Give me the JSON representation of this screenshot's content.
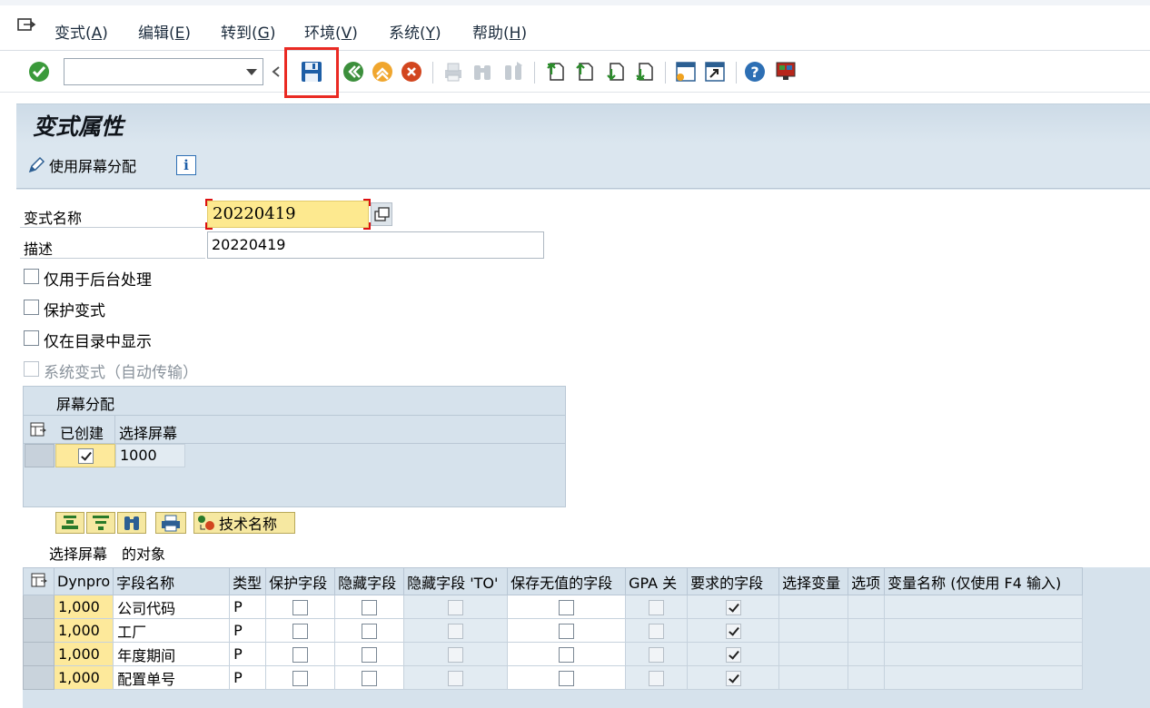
{
  "menubar": {
    "items": [
      {
        "label": "变式(",
        "key": "A",
        "tail": ")"
      },
      {
        "label": "编辑(",
        "key": "E",
        "tail": ")"
      },
      {
        "label": "转到(",
        "key": "G",
        "tail": ")"
      },
      {
        "label": "环境(",
        "key": "V",
        "tail": ")"
      },
      {
        "label": "系统(",
        "key": "Y",
        "tail": ")"
      },
      {
        "label": "帮助(",
        "key": "H",
        "tail": ")"
      }
    ]
  },
  "toolbar": {
    "command_field": "",
    "icons": [
      "enter-icon",
      "save-icon",
      "back-icon",
      "exit-icon",
      "cancel-icon",
      "print-icon",
      "find-icon",
      "find-next-icon",
      "first-page-icon",
      "previous-page-icon",
      "next-page-icon",
      "last-page-icon",
      "create-session-icon",
      "shortcut-icon",
      "help-icon",
      "customize-layout-icon"
    ],
    "highlight_color": "#ea2a23"
  },
  "title": "变式属性",
  "app_toolbar": {
    "use_screen_assignment": "使用屏幕分配",
    "info": "i"
  },
  "form": {
    "variant_name_label": "变式名称",
    "variant_name_value": "20220419",
    "description_label": "描述",
    "description_value": "20220419",
    "checkboxes": [
      {
        "label": "仅用于后台处理",
        "checked": false,
        "disabled": false
      },
      {
        "label": "保护变式",
        "checked": false,
        "disabled": false
      },
      {
        "label": "仅在目录中显示",
        "checked": false,
        "disabled": false
      },
      {
        "label": "系统变式（自动传输）",
        "checked": false,
        "disabled": true
      }
    ]
  },
  "screen_assignment": {
    "title": "屏幕分配",
    "columns": [
      "已创建",
      "选择屏幕"
    ],
    "rows": [
      {
        "created": true,
        "screen": "1000"
      }
    ]
  },
  "objects": {
    "toolbar_button": "技术名称",
    "title": "选择屏幕　的对象",
    "columns": [
      "Dynpro",
      "字段名称",
      "类型",
      "保护字段",
      "隐藏字段",
      "隐藏字段 'TO'",
      "保存无值的字段",
      "GPA 关",
      "要求的字段",
      "选择变量",
      "选项",
      "变量名称 (仅使用 F4 输入)"
    ],
    "rows": [
      {
        "dynpro": "1,000",
        "field": "公司代码",
        "type": "P",
        "required": true
      },
      {
        "dynpro": "1,000",
        "field": "工厂",
        "type": "P",
        "required": true
      },
      {
        "dynpro": "1,000",
        "field": "年度期间",
        "type": "P",
        "required": true
      },
      {
        "dynpro": "1,000",
        "field": "配置单号",
        "type": "P",
        "required": true
      }
    ]
  }
}
